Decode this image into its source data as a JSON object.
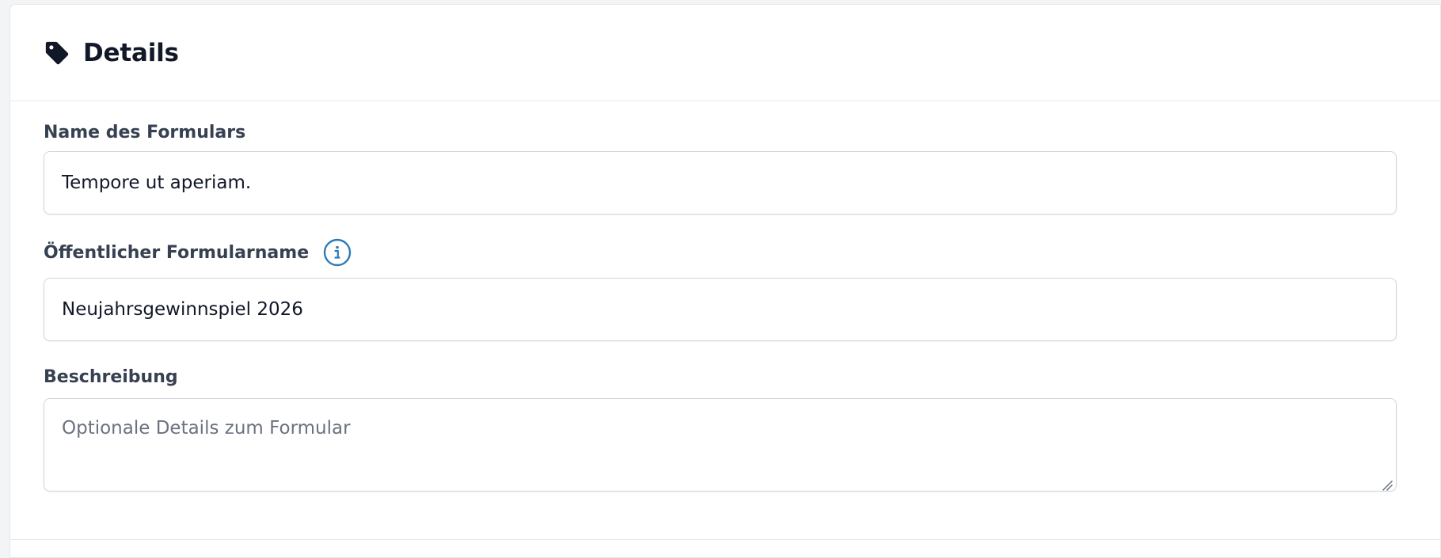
{
  "section": {
    "title": "Details",
    "icon": "tag-icon"
  },
  "form": {
    "name_label": "Name des Formulars",
    "name_value": "Tempore ut aperiam.",
    "public_label": "Öffentlicher Formularname",
    "public_value": "Neujahrsgewinnspiel 2026",
    "description_label": "Beschreibung",
    "description_placeholder": "Optionale Details zum Formular"
  },
  "colors": {
    "accent": "#2b7bb9",
    "text": "#111827",
    "muted": "#6b7280",
    "border": "#d1d5db"
  }
}
